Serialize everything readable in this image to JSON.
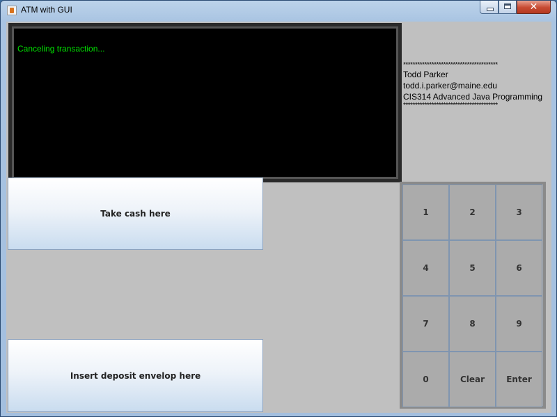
{
  "window": {
    "title": "ATM with GUI"
  },
  "screen": {
    "message": "Canceling transaction..."
  },
  "info": {
    "top_rule": "****************************************",
    "name": "Todd Parker",
    "email": "todd.i.parker@maine.edu",
    "course": "CIS314 Advanced Java Programming",
    "bottom_rule": "****************************************"
  },
  "slots": {
    "cash_label": "Take cash here",
    "deposit_label": "Insert deposit envelop here"
  },
  "keypad": {
    "keys": [
      "1",
      "2",
      "3",
      "4",
      "5",
      "6",
      "7",
      "8",
      "9",
      "0",
      "Clear",
      "Enter"
    ]
  },
  "colors": {
    "screen_text": "#00e000",
    "client_bg": "#c0c0c0",
    "screen_bg": "#000000"
  }
}
